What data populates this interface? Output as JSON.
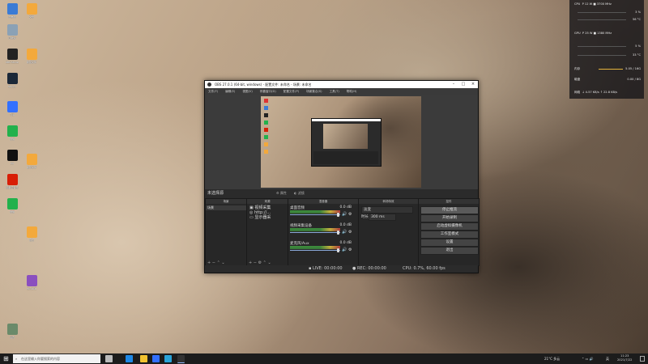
{
  "desktop": {
    "icons": [
      {
        "label": "此电脑",
        "color": "#3a7bd5"
      },
      {
        "label": "回收站",
        "color": "#8aa1b5"
      },
      {
        "label": "OBS Studio",
        "color": "#222222"
      },
      {
        "label": "Steam",
        "color": "#1b2838"
      },
      {
        "label": "飞书",
        "color": "#3370ff"
      },
      {
        "label": "微信",
        "color": "#22b14c"
      },
      {
        "label": "QQ",
        "color": "#111111"
      },
      {
        "label": "网易云音乐",
        "color": "#d81e06"
      },
      {
        "label": "微信",
        "color": "#22b14c"
      },
      {
        "label": "文档",
        "color": "#f3a93c"
      },
      {
        "label": "新建文件",
        "color": "#f3a93c"
      },
      {
        "label": "新建文件",
        "color": "#f3a93c"
      },
      {
        "label": "音乐",
        "color": "#f3a93c"
      },
      {
        "label": "WinRAR",
        "color": "#8a4fbf"
      },
      {
        "label": "设置",
        "color": "#6a8a6a"
      }
    ]
  },
  "monitor": {
    "cpu_label": "CPU",
    "cpu_freq": "P 12 W  ■ 3700 MHz",
    "cpu_usage": "3 %",
    "cpu_temp": "56 °C",
    "gpu_label": "GPU",
    "gpu_freq": "P 25 W  ■ 1380 MHz",
    "gpu_usage": "5 %",
    "gpu_temp": "33 °C",
    "mem_label": "内存",
    "mem_value": "5.05 / 16G",
    "disk_label": "磁盘",
    "disk_value": "0.00 / 8G",
    "net_label": "网络",
    "net_value": "↓ 4.57 KB/s  ↑ 22.8 KB/s"
  },
  "obs": {
    "window_title": "OBS 27.0.1 (64-bit, windows) - 配置文件: 未命名 - 场景: 未命名",
    "menu": [
      "文件(F)",
      "编辑(E)",
      "视图(V)",
      "停靠窗口(D)",
      "配置文件(P)",
      "场景集合(S)",
      "工具(T)",
      "帮助(H)"
    ],
    "scene_label": "未选择源",
    "props_label": "属性",
    "filters_label": "滤镜",
    "docks": {
      "scenes_header": "场景",
      "sources_header": "来源",
      "mixer_header": "混音器",
      "transitions_header": "转场特效",
      "controls_header": "控件"
    },
    "scenes": [
      "场景"
    ],
    "sources": [
      "视频采集",
      "http://...",
      "显示器采"
    ],
    "mixer": [
      {
        "name": "桌面音频",
        "db": "0.0 dB",
        "level": 0.55
      },
      {
        "name": "视频采集设备",
        "db": "0.0 dB",
        "level": 0.0
      },
      {
        "name": "麦克风/Aux",
        "db": "0.0 dB",
        "level": 0.7
      }
    ],
    "transitions": {
      "type": "淡变",
      "duration_label": "时长",
      "duration": "300 ms"
    },
    "controls": [
      "停止推流",
      "开始录制",
      "启动虚拟摄像机",
      "工作室模式",
      "设置",
      "退出"
    ],
    "status": {
      "live": "LIVE: 00:00:00",
      "rec": "REC: 00:00:00",
      "cpu": "CPU: 0.7%, 60.00 fps"
    }
  },
  "taskbar": {
    "search_placeholder": "在这里输入你要搜索的内容",
    "weather": "21°C 多云",
    "ime": "英",
    "time": "11:23",
    "date": "2021/7/22"
  }
}
